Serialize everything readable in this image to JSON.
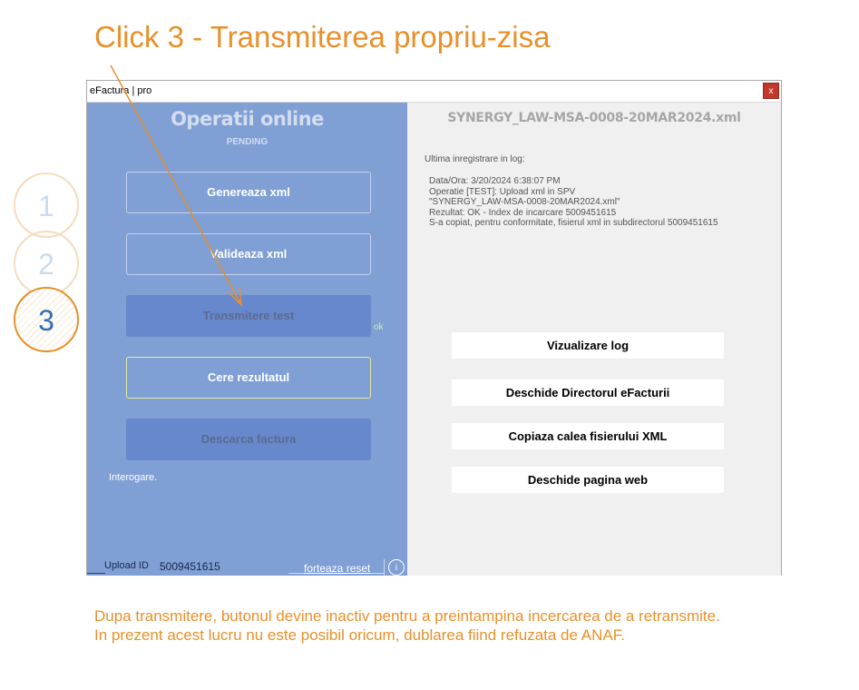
{
  "heading": "Click 3 - Transmiterea propriu-zisa",
  "window": {
    "title": "eFactura | pro",
    "close_label": "x"
  },
  "left_panel": {
    "title": "Operatii online",
    "status": "PENDING",
    "buttons": [
      {
        "label": "Genereaza xml",
        "state": "enabled"
      },
      {
        "label": "Valideaza xml",
        "state": "enabled"
      },
      {
        "label": "Transmitere test",
        "state": "disabled"
      },
      {
        "label": "Cere rezultatul",
        "state": "enabled-highlighted"
      },
      {
        "label": "Descarca factura",
        "state": "disabled"
      }
    ],
    "ok_mark": "ok",
    "query_status": "Interogare.",
    "upload_id_label": "Upload ID",
    "upload_id_value": "5009451615",
    "reset_link": "forteaza reset",
    "info_icon": "i"
  },
  "right_panel": {
    "file_name": "SYNERGY_LAW-MSA-0008-20MAR2024.xml",
    "log_label": "Ultima inregistrare in log:",
    "log_lines": [
      "Data/Ora: 3/20/2024 6:38:07 PM",
      "Operatie [TEST]: Upload xml in SPV",
      "\"SYNERGY_LAW-MSA-0008-20MAR2024.xml\"",
      "Rezultat: OK - Index de incarcare 5009451615",
      "S-a copiat, pentru conformitate, fisierul xml in subdirectorul 5009451615"
    ],
    "actions": [
      "Vizualizare log",
      "Deschide Directorul eFacturii",
      "Copiaza calea fisierului XML",
      "Deschide pagina web"
    ]
  },
  "step_circles": [
    "1",
    "2",
    "3"
  ],
  "footer": {
    "line1": "Dupa transmitere, butonul devine inactiv pentru a preintampina incercarea de a retransmite.",
    "line2": "In prezent acest lucru nu este posibil oricum, dublarea fiind refuzata de ANAF."
  },
  "colors": {
    "accent_orange": "#e8902a",
    "panel_blue": "#7f9fd5",
    "disabled_button": "#6788cc",
    "step_active_number": "#2f6fb5"
  }
}
